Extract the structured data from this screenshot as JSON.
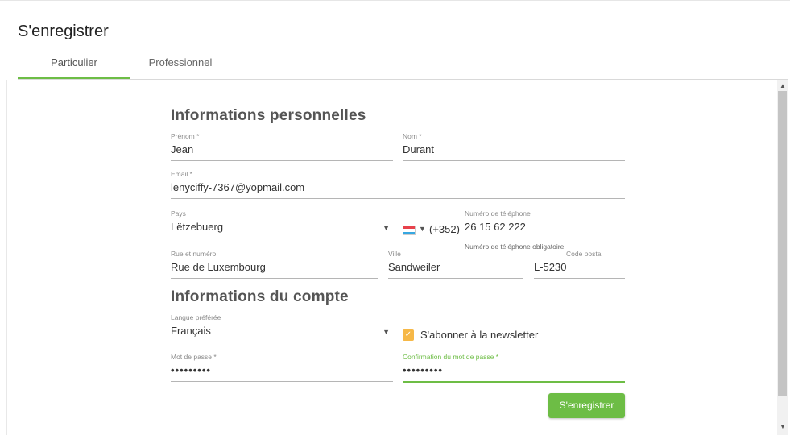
{
  "page": {
    "title": "S'enregistrer"
  },
  "tabs": [
    {
      "label": "Particulier",
      "active": true
    },
    {
      "label": "Professionnel",
      "active": false
    }
  ],
  "personal": {
    "title": "Informations personnelles",
    "firstname": {
      "label": "Prénom *",
      "value": "Jean"
    },
    "lastname": {
      "label": "Nom *",
      "value": "Durant"
    },
    "email": {
      "label": "Email *",
      "value": "lenyciffy-7367@yopmail.com"
    },
    "country": {
      "label": "Pays",
      "value": "Lëtzebuerg"
    },
    "phone": {
      "label": "Numéro de téléphone",
      "prefix": "(+352)",
      "value": "26 15 62 222",
      "helper": "Numéro de téléphone obligatoire"
    },
    "street": {
      "label": "Rue et numéro",
      "value": "Rue de Luxembourg"
    },
    "city": {
      "label": "Ville",
      "value": "Sandweiler"
    },
    "postal": {
      "label": "Code postal",
      "value": "L-5230"
    }
  },
  "account": {
    "title": "Informations du compte",
    "language": {
      "label": "Langue préférée",
      "value": "Français"
    },
    "newsletter": {
      "label": "S'abonner à la newsletter",
      "checked": true
    },
    "password": {
      "label": "Mot de passe *",
      "value": "•••••••••"
    },
    "password_confirm": {
      "label": "Confirmation du mot de passe *",
      "value": "•••••••••"
    }
  },
  "submit": {
    "label": "S'enregistrer"
  },
  "colors": {
    "accent": "#6dbd45",
    "checkbox": "#f6b847"
  },
  "icons": {
    "dropdown": "caret-down-icon",
    "flag": "luxembourg-flag-icon",
    "check": "check-icon"
  }
}
